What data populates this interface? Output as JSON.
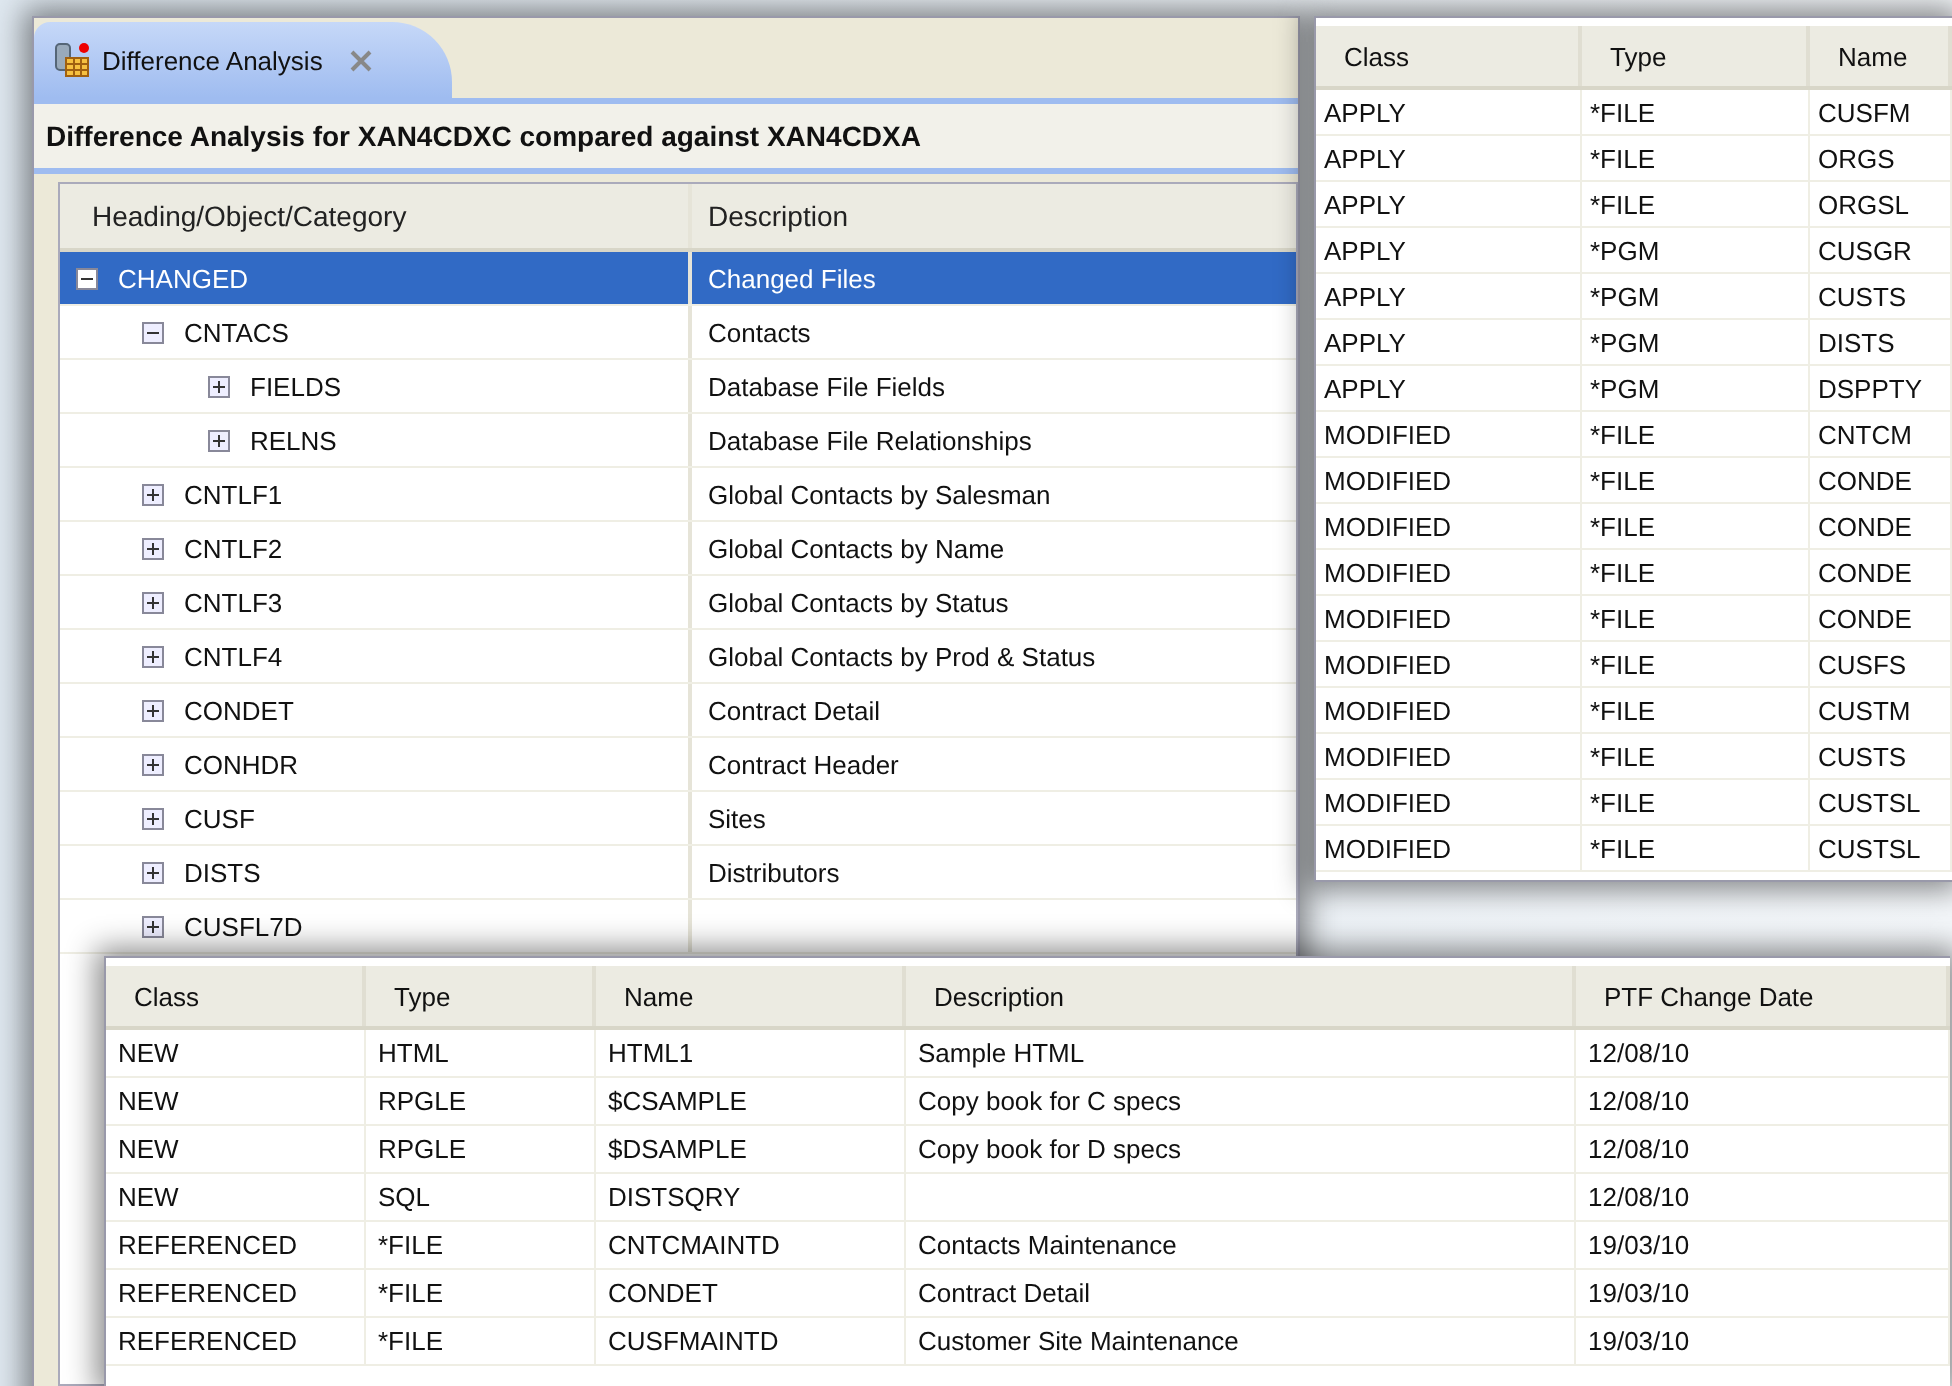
{
  "main_window": {
    "tab": {
      "label": "Difference Analysis",
      "selected": true
    },
    "heading": "Difference Analysis for XAN4CDXC compared against XAN4CDXA",
    "columns": [
      "Heading/Object/Category",
      "Description"
    ],
    "tree": [
      {
        "name": "CHANGED",
        "description": "Changed Files",
        "expanded": true,
        "selected": true,
        "children": [
          {
            "name": "CNTACS",
            "description": "Contacts",
            "expanded": true,
            "selected": false,
            "children": [
              {
                "name": "FIELDS",
                "description": "Database File Fields",
                "expanded": false,
                "selected": false
              },
              {
                "name": "RELNS",
                "description": "Database File Relationships",
                "expanded": false,
                "selected": false
              }
            ]
          },
          {
            "name": "CNTLF1",
            "description": "Global Contacts by Salesman",
            "expanded": false,
            "selected": false
          },
          {
            "name": "CNTLF2",
            "description": "Global Contacts by Name",
            "expanded": false,
            "selected": false
          },
          {
            "name": "CNTLF3",
            "description": "Global Contacts by Status",
            "expanded": false,
            "selected": false
          },
          {
            "name": "CNTLF4",
            "description": "Global Contacts by Prod & Status",
            "expanded": false,
            "selected": false
          },
          {
            "name": "CONDET",
            "description": "Contract Detail",
            "expanded": false,
            "selected": false
          },
          {
            "name": "CONHDR",
            "description": "Contract Header",
            "expanded": false,
            "selected": false
          },
          {
            "name": "CUSF",
            "description": "Sites",
            "expanded": false,
            "selected": false
          },
          {
            "name": "DISTS",
            "description": "Distributors",
            "expanded": false,
            "selected": false
          },
          {
            "name": "CUSFL7D",
            "expanded": false,
            "selected": false
          }
        ]
      }
    ]
  },
  "right_table": {
    "columns": [
      "Class",
      "Type",
      "Name"
    ],
    "rows": [
      [
        "APPLY",
        "*FILE",
        "CUSFM"
      ],
      [
        "APPLY",
        "*FILE",
        "ORGS"
      ],
      [
        "APPLY",
        "*FILE",
        "ORGSL"
      ],
      [
        "APPLY",
        "*PGM",
        "CUSGR"
      ],
      [
        "APPLY",
        "*PGM",
        "CUSTS"
      ],
      [
        "APPLY",
        "*PGM",
        "DISTS"
      ],
      [
        "APPLY",
        "*PGM",
        "DSPPTY"
      ],
      [
        "MODIFIED",
        "*FILE",
        "CNTCM"
      ],
      [
        "MODIFIED",
        "*FILE",
        "CONDE"
      ],
      [
        "MODIFIED",
        "*FILE",
        "CONDE"
      ],
      [
        "MODIFIED",
        "*FILE",
        "CONDE"
      ],
      [
        "MODIFIED",
        "*FILE",
        "CONDE"
      ],
      [
        "MODIFIED",
        "*FILE",
        "CUSFS"
      ],
      [
        "MODIFIED",
        "*FILE",
        "CUSTM"
      ],
      [
        "MODIFIED",
        "*FILE",
        "CUSTS"
      ],
      [
        "MODIFIED",
        "*FILE",
        "CUSTSL"
      ],
      [
        "MODIFIED",
        "*FILE",
        "CUSTSL"
      ]
    ]
  },
  "bottom_table": {
    "columns": [
      "Class",
      "Type",
      "Name",
      "Description",
      "PTF Change Date"
    ],
    "rows": [
      [
        "NEW",
        "HTML",
        "HTML1",
        "Sample HTML",
        "12/08/10"
      ],
      [
        "NEW",
        "RPGLE",
        "$CSAMPLE",
        "Copy book for C specs",
        "12/08/10"
      ],
      [
        "NEW",
        "RPGLE",
        "$DSAMPLE",
        "Copy book for D specs",
        "12/08/10"
      ],
      [
        "NEW",
        "SQL",
        "DISTSQRY",
        "",
        "12/08/10"
      ],
      [
        "REFERENCED",
        "*FILE",
        "CNTCMAINTD",
        "Contacts Maintenance",
        "19/03/10"
      ],
      [
        "REFERENCED",
        "*FILE",
        "CONDET",
        "Contract Detail",
        "19/03/10"
      ],
      [
        "REFERENCED",
        "*FILE",
        "CUSFMAINTD",
        "Customer Site Maintenance",
        "19/03/10"
      ]
    ]
  }
}
